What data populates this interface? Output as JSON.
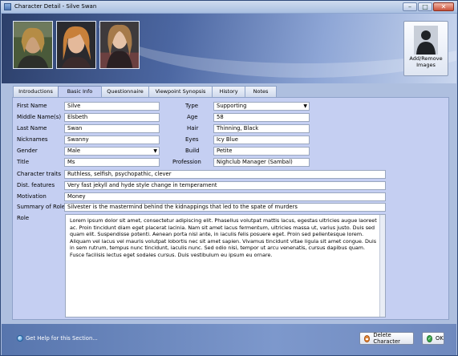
{
  "window": {
    "title": "Character Detail - Silve Swan",
    "minimize": "–",
    "maximize": "□",
    "close": "✕"
  },
  "header": {
    "add_remove_label": "Add/Remove Images"
  },
  "tabs": [
    {
      "label": "Introductions",
      "active": false
    },
    {
      "label": "Basic Info",
      "active": true
    },
    {
      "label": "Questionnaire",
      "active": false
    },
    {
      "label": "Viewpoint Synopsis",
      "active": false
    },
    {
      "label": "History",
      "active": false
    },
    {
      "label": "Notes",
      "active": false
    }
  ],
  "form": {
    "first_name": {
      "label": "First Name",
      "value": "Silve"
    },
    "middle_names": {
      "label": "Middle Name(s)",
      "value": "Elsbeth"
    },
    "last_name": {
      "label": "Last Name",
      "value": "Swan"
    },
    "nicknames": {
      "label": "Nicknames",
      "value": "Swanny"
    },
    "gender": {
      "label": "Gender",
      "value": "Male"
    },
    "title": {
      "label": "Title",
      "value": "Ms"
    },
    "type": {
      "label": "Type",
      "value": "Supporting"
    },
    "age": {
      "label": "Age",
      "value": "58"
    },
    "hair": {
      "label": "Hair",
      "value": "Thinning, Black"
    },
    "eyes": {
      "label": "Eyes",
      "value": "Icy Blue"
    },
    "build": {
      "label": "Build",
      "value": "Petite"
    },
    "profession": {
      "label": "Profession",
      "value": "Nighclub Manager (Sambal)"
    },
    "character_traits": {
      "label": "Character traits",
      "value": "Ruthless, selfish, psychopathic, clever"
    },
    "dist_features": {
      "label": "Dist. features",
      "value": "Very fast jekyll and hyde style change in temperament"
    },
    "motivation": {
      "label": "Motivation",
      "value": "Money"
    },
    "summary_of_role": {
      "label": "Summary of Role",
      "value": "Silvester is the mastermind behind the kidnappings that led to the spate of murders"
    },
    "role": {
      "label": "Role",
      "value": "Lorem ipsum dolor sit amet, consectetur adipiscing elit. Phasellus volutpat mattis lacus, egestas ultricies augue laoreet ac. Proin tincidunt diam eget placerat lacinia. Nam sit amet lacus fermentum, ultricies massa ut, varius justo. Duis sed quam elit. Suspendisse potenti. Aenean porta nisl ante, in iaculis felis posuere eget. Proin sed pellentesque lorem. Aliquam vel lacus vel mauris volutpat lobortis nec sit amet sapien. Vivamus tincidunt vitae ligula sit amet congue. Duis in sem rutrum, tempus nunc tincidunt, iaculis nunc. Sed odio nisi, tempor ut arcu venenatis, cursus dapibus quam. Fusce facilisis lectus eget sodales cursus. Duis vestibulum eu ipsum eu ornare."
    }
  },
  "footer": {
    "help_label": "Get Help for this Section...",
    "delete_label": "Delete Character",
    "ok_label": "OK"
  },
  "icons": {
    "app": "app-icon",
    "help": "help-icon",
    "delete": "delete-icon",
    "ok": "check-icon",
    "person": "person-silhouette-icon"
  }
}
